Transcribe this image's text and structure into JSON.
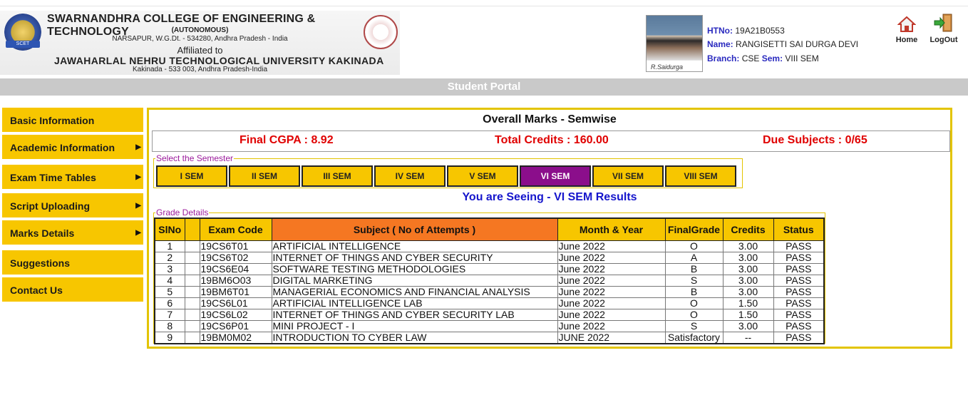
{
  "header": {
    "college_name": "SWARNANDHRA COLLEGE OF ENGINEERING & TECHNOLOGY",
    "autonomous": "(AUTONOMOUS)",
    "address": "NARSAPUR, W.G.Dt. - 534280, Andhra Pradesh - India",
    "affiliated": "Affiliated to",
    "university": "JAWAHARLAL NEHRU TECHNOLOGICAL UNIVERSITY KAKINADA",
    "university_address": "Kakinada - 533 003, Andhra Pradesh-India",
    "photo_signature": "R.Saidurga"
  },
  "student": {
    "htno_label": "HTNo:",
    "htno": "19A21B0553",
    "name_label": "Name:",
    "name": "RANGISETTI SAI DURGA DEVI",
    "branch_label": "Branch:",
    "branch": "CSE",
    "sem_label": "Sem:",
    "sem": "VIII SEM"
  },
  "topnav": {
    "home": "Home",
    "logout": "LogOut"
  },
  "portal_title": "Student Portal",
  "sidebar": {
    "items": [
      {
        "label": "Basic Information",
        "arrow": ""
      },
      {
        "label": "Academic Information",
        "arrow": "▶"
      },
      {
        "label": "Exam Time Tables",
        "arrow": "▶"
      },
      {
        "label": "Script Uploading",
        "arrow": "▶"
      },
      {
        "label": "Marks Details",
        "arrow": "▶"
      },
      {
        "label": "Suggestions",
        "arrow": ""
      },
      {
        "label": "Contact Us",
        "arrow": ""
      }
    ]
  },
  "main": {
    "title": "Overall Marks - Semwise",
    "cgpa": "Final CGPA : 8.92",
    "credits": "Total Credits : 160.00",
    "due": "Due Subjects : 0/65",
    "semester_legend": "Select the Semester",
    "semesters": [
      "I SEM",
      "II SEM",
      "III SEM",
      "IV SEM",
      "V SEM",
      "VI SEM",
      "VII SEM",
      "VIII SEM"
    ],
    "selected_semester": "VI SEM",
    "seeing": "You are Seeing - VI SEM Results",
    "grade_legend": "Grade Details",
    "columns": [
      "SlNo",
      "",
      "Exam Code",
      "Subject ( No of Attempts )",
      "Month & Year",
      "FinalGrade",
      "Credits",
      "Status"
    ],
    "rows": [
      [
        "1",
        "",
        "19CS6T01",
        "ARTIFICIAL INTELLIGENCE",
        "June 2022",
        "O",
        "3.00",
        "PASS"
      ],
      [
        "2",
        "",
        "19CS6T02",
        "INTERNET OF THINGS AND CYBER SECURITY",
        "June 2022",
        "A",
        "3.00",
        "PASS"
      ],
      [
        "3",
        "",
        "19CS6E04",
        "SOFTWARE TESTING METHODOLOGIES",
        "June 2022",
        "B",
        "3.00",
        "PASS"
      ],
      [
        "4",
        "",
        "19BM6O03",
        "DIGITAL MARKETING",
        "June 2022",
        "S",
        "3.00",
        "PASS"
      ],
      [
        "5",
        "",
        "19BM6T01",
        "MANAGERIAL ECONOMICS AND FINANCIAL ANALYSIS",
        "June 2022",
        "B",
        "3.00",
        "PASS"
      ],
      [
        "6",
        "",
        "19CS6L01",
        "ARTIFICIAL INTELLIGENCE LAB",
        "June 2022",
        "O",
        "1.50",
        "PASS"
      ],
      [
        "7",
        "",
        "19CS6L02",
        "INTERNET OF THINGS AND CYBER SECURITY LAB",
        "June 2022",
        "O",
        "1.50",
        "PASS"
      ],
      [
        "8",
        "",
        "19CS6P01",
        "MINI PROJECT - I",
        "June 2022",
        "S",
        "3.00",
        "PASS"
      ],
      [
        "9",
        "",
        "19BM0M02",
        "INTRODUCTION TO CYBER LAW",
        "JUNE 2022",
        "Satisfactory",
        "--",
        "PASS"
      ]
    ]
  },
  "colors": {
    "accent_yellow": "#f7c600",
    "selected_purple": "#8b0e8b",
    "subject_header_orange": "#f57722",
    "summary_red": "#e00000",
    "seeing_blue": "#1515cc"
  }
}
